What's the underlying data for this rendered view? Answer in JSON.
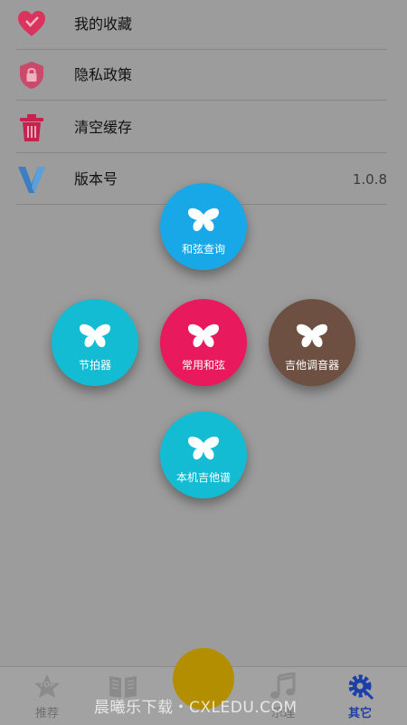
{
  "settings": {
    "items": [
      {
        "label": "我的收藏",
        "icon": "heart-icon"
      },
      {
        "label": "隐私政策",
        "icon": "shield-lock-icon"
      },
      {
        "label": "清空缓存",
        "icon": "trash-icon"
      },
      {
        "label": "版本号",
        "icon": "version-v-icon",
        "value": "1.0.8"
      }
    ]
  },
  "radial_menu": {
    "buttons": [
      {
        "label": "和弦查询",
        "color": "#18a8e8",
        "icon": "butterfly-icon"
      },
      {
        "label": "节拍器",
        "color": "#14bcd3",
        "icon": "butterfly-icon"
      },
      {
        "label": "常用和弦",
        "color": "#e8195d",
        "icon": "butterfly-icon"
      },
      {
        "label": "吉他调音器",
        "color": "#6e5042",
        "icon": "butterfly-icon"
      },
      {
        "label": "本机吉他谱",
        "color": "#14bcd3",
        "icon": "butterfly-icon"
      }
    ]
  },
  "bottom_nav": {
    "items": [
      {
        "label": "推荐",
        "icon": "top-star-icon",
        "active": false
      },
      {
        "label": "",
        "icon": "book-icon",
        "active": false
      },
      {
        "label": "乐理",
        "icon": "music-note-icon",
        "active": false
      },
      {
        "label": "其它",
        "icon": "gear-icon",
        "active": true
      }
    ],
    "center_button_color": "#b38f00"
  },
  "watermark": "晨曦乐下载・CXLEDU.COM"
}
